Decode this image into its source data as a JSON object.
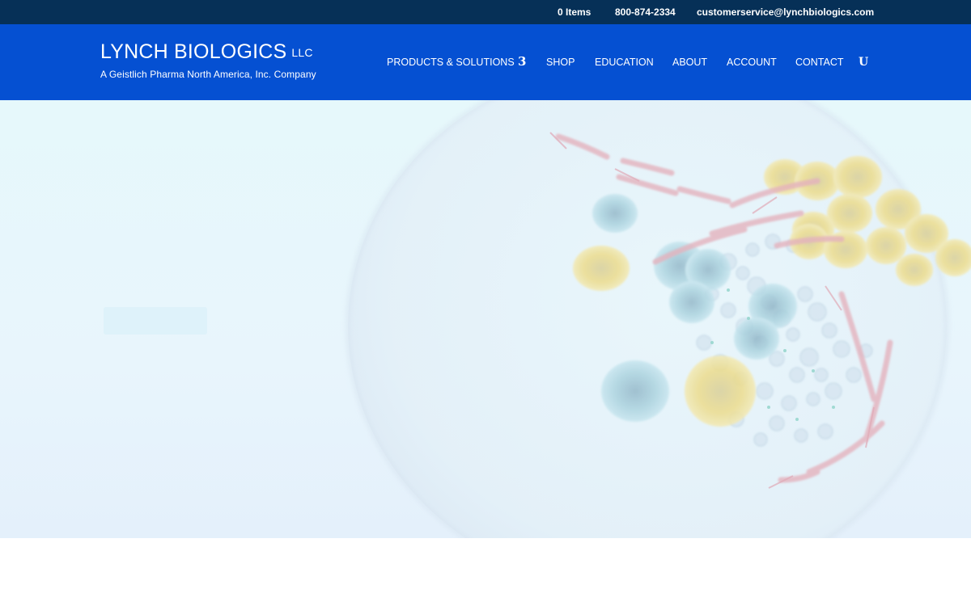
{
  "topbar": {
    "cart_items": "0 Items",
    "phone": "800-874-2334",
    "email": "customerservice@lynchbiologics.com"
  },
  "header": {
    "logo": {
      "name": "LYNCH BIOLOGICS",
      "suffix": "LLC",
      "tagline": "A Geistlich Pharma North America, Inc. Company"
    },
    "nav": {
      "products": "PRODUCTS & SOLUTIONS",
      "products_chevron": "3",
      "shop": "SHOP",
      "education": "EDUCATION",
      "about": "ABOUT",
      "account": "ACCOUNT",
      "contact": "CONTACT",
      "cart_glyph": "U"
    }
  },
  "icons": {
    "chevron": "chevron-down-icon",
    "cart": "shopping-cart-icon"
  },
  "colors": {
    "topbar_bg": "#063057",
    "header_bg": "#0550d2",
    "hero_bg": "#e6f8fb",
    "text_on_dark": "#ffffff"
  }
}
